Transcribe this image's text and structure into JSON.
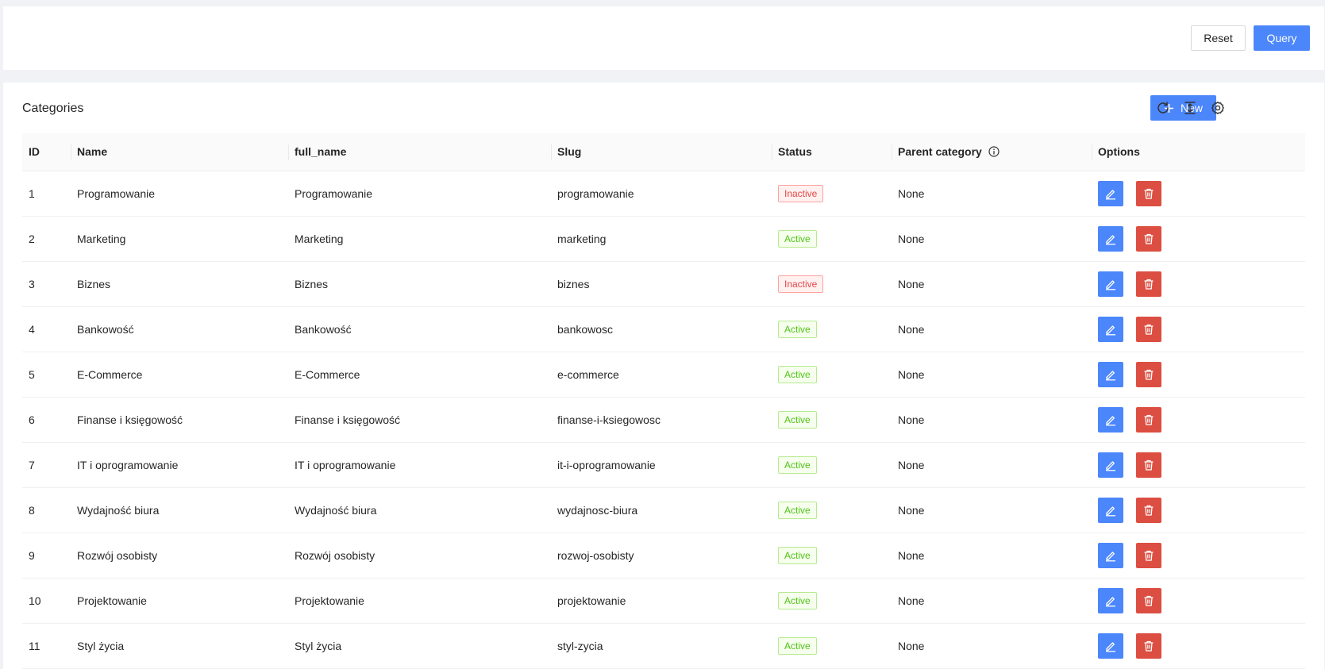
{
  "search": {
    "reset_label": "Reset",
    "query_label": "Query"
  },
  "table": {
    "title": "Categories",
    "new_label": "New",
    "columns": {
      "id": "ID",
      "name": "Name",
      "full_name": "full_name",
      "slug": "Slug",
      "status": "Status",
      "parent": "Parent category",
      "options": "Options"
    },
    "rows": [
      {
        "id": "1",
        "name": "Programowanie",
        "full_name": "Programowanie",
        "slug": "programowanie",
        "status": "Inactive",
        "parent": "None"
      },
      {
        "id": "2",
        "name": "Marketing",
        "full_name": "Marketing",
        "slug": "marketing",
        "status": "Active",
        "parent": "None"
      },
      {
        "id": "3",
        "name": "Biznes",
        "full_name": "Biznes",
        "slug": "biznes",
        "status": "Inactive",
        "parent": "None"
      },
      {
        "id": "4",
        "name": "Bankowość",
        "full_name": "Bankowość",
        "slug": "bankowosc",
        "status": "Active",
        "parent": "None"
      },
      {
        "id": "5",
        "name": "E-Commerce",
        "full_name": "E-Commerce",
        "slug": "e-commerce",
        "status": "Active",
        "parent": "None"
      },
      {
        "id": "6",
        "name": "Finanse i księgowość",
        "full_name": "Finanse i księgowość",
        "slug": "finanse-i-ksiegowosc",
        "status": "Active",
        "parent": "None"
      },
      {
        "id": "7",
        "name": "IT i oprogramowanie",
        "full_name": "IT i oprogramowanie",
        "slug": "it-i-oprogramowanie",
        "status": "Active",
        "parent": "None"
      },
      {
        "id": "8",
        "name": "Wydajność biura",
        "full_name": "Wydajność biura",
        "slug": "wydajnosc-biura",
        "status": "Active",
        "parent": "None"
      },
      {
        "id": "9",
        "name": "Rozwój osobisty",
        "full_name": "Rozwój osobisty",
        "slug": "rozwoj-osobisty",
        "status": "Active",
        "parent": "None"
      },
      {
        "id": "10",
        "name": "Projektowanie",
        "full_name": "Projektowanie",
        "slug": "projektowanie",
        "status": "Active",
        "parent": "None"
      },
      {
        "id": "11",
        "name": "Styl życia",
        "full_name": "Styl życia",
        "slug": "styl-zycia",
        "status": "Active",
        "parent": "None"
      }
    ]
  },
  "icons": {
    "new": "plus-icon",
    "reload": "reload-icon",
    "density": "column-height-icon",
    "settings": "gear-icon",
    "parent_info": "info-circle-icon",
    "edit": "edit-icon",
    "delete": "delete-icon"
  },
  "colors": {
    "primary": "#4b86fb",
    "danger": "#dc4e41",
    "inactive_tag": "#e04848",
    "active_tag": "#52c41a"
  }
}
